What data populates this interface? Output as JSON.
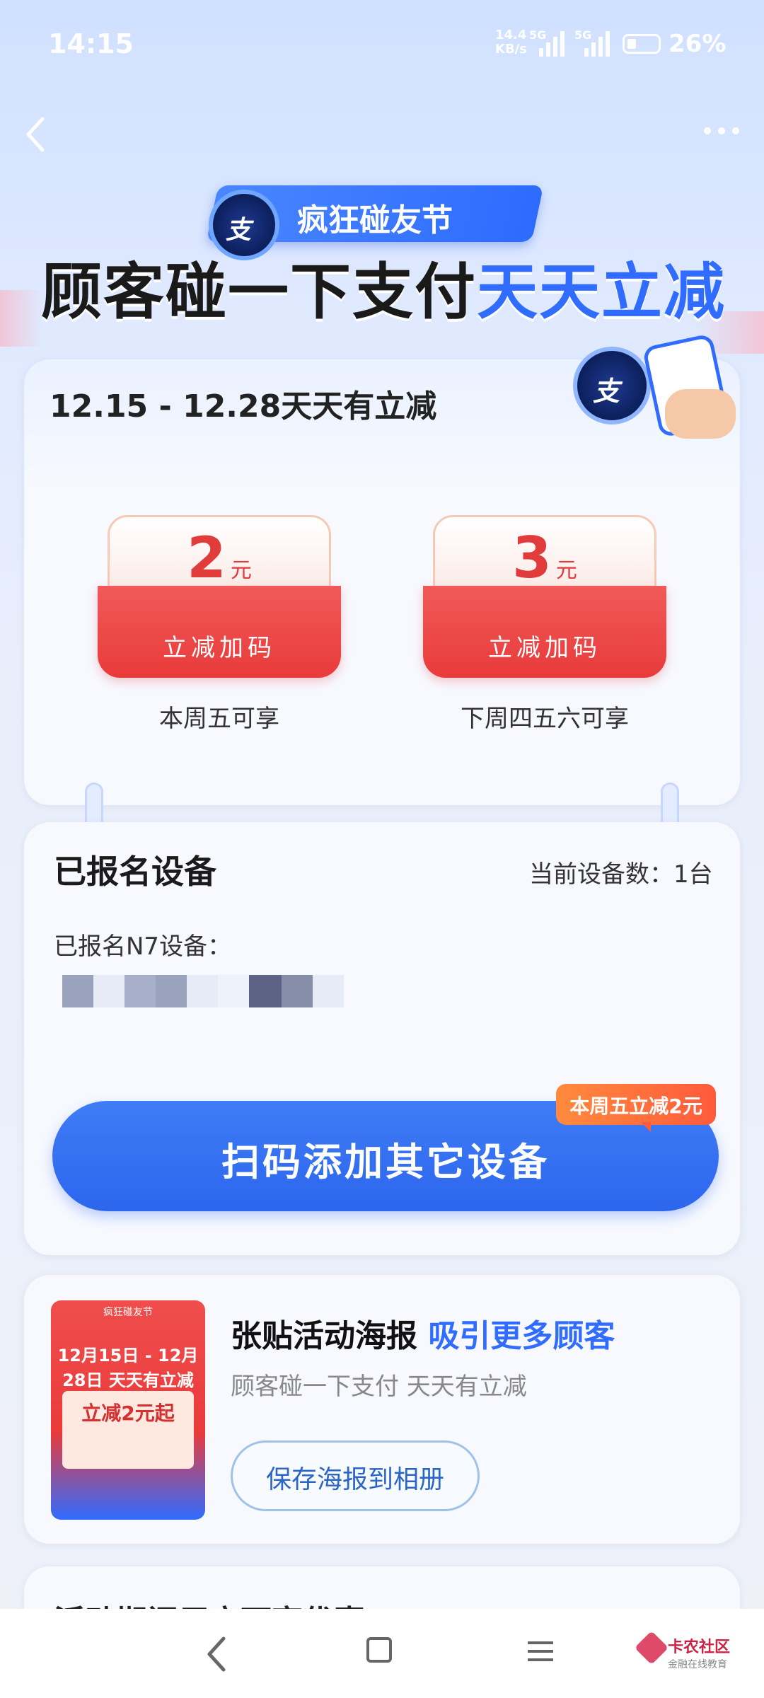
{
  "status_bar": {
    "time": "14:15",
    "net_speed_top": "14.4",
    "net_speed_bottom": "KB/s",
    "net1": "5G",
    "net2": "5G",
    "battery": "26%"
  },
  "hero": {
    "badge": "疯狂碰友节",
    "logo_text": "支",
    "title_black": "顾客碰一下支付",
    "title_blue": "天天立减"
  },
  "promo_card": {
    "title": "12.15 - 12.28天天有立减",
    "deco_logo_text": "支",
    "coupons": [
      {
        "amount": "2",
        "unit": "元",
        "label": "立减加码",
        "caption": "本周五可享"
      },
      {
        "amount": "3",
        "unit": "元",
        "label": "立减加码",
        "caption": "下周四五六可享"
      }
    ]
  },
  "registered": {
    "title": "已报名设备",
    "device_count": "当前设备数：1台",
    "sub_label": "已报名N7设备：",
    "scan_button": "扫码添加其它设备",
    "tag": "本周五立减2元"
  },
  "poster_card": {
    "poster_top": "疯狂碰友节",
    "poster_headline": "12月15日 - 12月28日 天天有立减",
    "poster_amount": "立减2元起",
    "title_black": "张贴活动海报",
    "title_blue": "吸引更多顾客",
    "subtitle": "顾客碰一下支付 天天有立减",
    "save_button": "保存海报到相册"
  },
  "next_card": {
    "title": "活动期间用户可享优惠"
  },
  "watermark": {
    "name": "卡农社区",
    "sub": "金融在线教育"
  },
  "colors": {
    "accent_blue": "#2f6cff",
    "coupon_red": "#e93a3a",
    "tag_orange": "#ff6a3c"
  }
}
